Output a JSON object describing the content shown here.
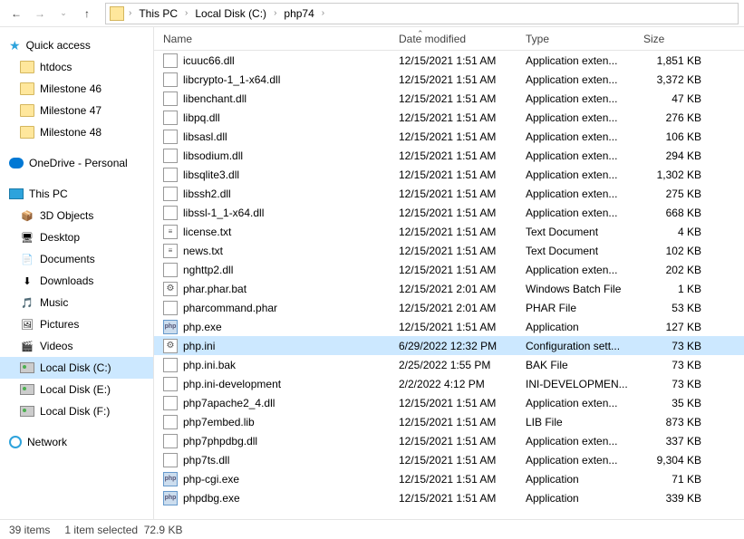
{
  "breadcrumbs": [
    "This PC",
    "Local Disk (C:)",
    "php74"
  ],
  "sidebar": {
    "quick": {
      "label": "Quick access",
      "items": [
        "htdocs",
        "Milestone 46",
        "Milestone 47",
        "Milestone 48"
      ]
    },
    "onedrive": "OneDrive - Personal",
    "thispc": {
      "label": "This PC",
      "items": [
        {
          "label": "3D Objects",
          "ico": "📦"
        },
        {
          "label": "Desktop",
          "ico": "🖥"
        },
        {
          "label": "Documents",
          "ico": "📄"
        },
        {
          "label": "Downloads",
          "ico": "⬇"
        },
        {
          "label": "Music",
          "ico": "🎵"
        },
        {
          "label": "Pictures",
          "ico": "🖼"
        },
        {
          "label": "Videos",
          "ico": "🎬"
        },
        {
          "label": "Local Disk (C:)",
          "ico": "drv",
          "sel": true
        },
        {
          "label": "Local Disk (E:)",
          "ico": "drv"
        },
        {
          "label": "Local Disk (F:)",
          "ico": "drv"
        }
      ]
    },
    "network": "Network"
  },
  "columns": {
    "name": "Name",
    "date": "Date modified",
    "type": "Type",
    "size": "Size"
  },
  "files": [
    {
      "n": "icuuc66.dll",
      "d": "12/15/2021 1:51 AM",
      "t": "Application exten...",
      "s": "1,851 KB",
      "i": "dll"
    },
    {
      "n": "libcrypto-1_1-x64.dll",
      "d": "12/15/2021 1:51 AM",
      "t": "Application exten...",
      "s": "3,372 KB",
      "i": "dll"
    },
    {
      "n": "libenchant.dll",
      "d": "12/15/2021 1:51 AM",
      "t": "Application exten...",
      "s": "47 KB",
      "i": "dll"
    },
    {
      "n": "libpq.dll",
      "d": "12/15/2021 1:51 AM",
      "t": "Application exten...",
      "s": "276 KB",
      "i": "dll"
    },
    {
      "n": "libsasl.dll",
      "d": "12/15/2021 1:51 AM",
      "t": "Application exten...",
      "s": "106 KB",
      "i": "dll"
    },
    {
      "n": "libsodium.dll",
      "d": "12/15/2021 1:51 AM",
      "t": "Application exten...",
      "s": "294 KB",
      "i": "dll"
    },
    {
      "n": "libsqlite3.dll",
      "d": "12/15/2021 1:51 AM",
      "t": "Application exten...",
      "s": "1,302 KB",
      "i": "dll"
    },
    {
      "n": "libssh2.dll",
      "d": "12/15/2021 1:51 AM",
      "t": "Application exten...",
      "s": "275 KB",
      "i": "dll"
    },
    {
      "n": "libssl-1_1-x64.dll",
      "d": "12/15/2021 1:51 AM",
      "t": "Application exten...",
      "s": "668 KB",
      "i": "dll"
    },
    {
      "n": "license.txt",
      "d": "12/15/2021 1:51 AM",
      "t": "Text Document",
      "s": "4 KB",
      "i": "txt"
    },
    {
      "n": "news.txt",
      "d": "12/15/2021 1:51 AM",
      "t": "Text Document",
      "s": "102 KB",
      "i": "txt"
    },
    {
      "n": "nghttp2.dll",
      "d": "12/15/2021 1:51 AM",
      "t": "Application exten...",
      "s": "202 KB",
      "i": "dll"
    },
    {
      "n": "phar.phar.bat",
      "d": "12/15/2021 2:01 AM",
      "t": "Windows Batch File",
      "s": "1 KB",
      "i": "bat"
    },
    {
      "n": "pharcommand.phar",
      "d": "12/15/2021 2:01 AM",
      "t": "PHAR File",
      "s": "53 KB",
      "i": "gen"
    },
    {
      "n": "php.exe",
      "d": "12/15/2021 1:51 AM",
      "t": "Application",
      "s": "127 KB",
      "i": "exe"
    },
    {
      "n": "php.ini",
      "d": "6/29/2022 12:32 PM",
      "t": "Configuration sett...",
      "s": "73 KB",
      "i": "ini",
      "sel": true
    },
    {
      "n": "php.ini.bak",
      "d": "2/25/2022 1:55 PM",
      "t": "BAK File",
      "s": "73 KB",
      "i": "gen"
    },
    {
      "n": "php.ini-development",
      "d": "2/2/2022 4:12 PM",
      "t": "INI-DEVELOPMEN...",
      "s": "73 KB",
      "i": "gen"
    },
    {
      "n": "php7apache2_4.dll",
      "d": "12/15/2021 1:51 AM",
      "t": "Application exten...",
      "s": "35 KB",
      "i": "dll"
    },
    {
      "n": "php7embed.lib",
      "d": "12/15/2021 1:51 AM",
      "t": "LIB File",
      "s": "873 KB",
      "i": "gen"
    },
    {
      "n": "php7phpdbg.dll",
      "d": "12/15/2021 1:51 AM",
      "t": "Application exten...",
      "s": "337 KB",
      "i": "dll"
    },
    {
      "n": "php7ts.dll",
      "d": "12/15/2021 1:51 AM",
      "t": "Application exten...",
      "s": "9,304 KB",
      "i": "dll"
    },
    {
      "n": "php-cgi.exe",
      "d": "12/15/2021 1:51 AM",
      "t": "Application",
      "s": "71 KB",
      "i": "exe"
    },
    {
      "n": "phpdbg.exe",
      "d": "12/15/2021 1:51 AM",
      "t": "Application",
      "s": "339 KB",
      "i": "exe"
    }
  ],
  "status": {
    "items": "39 items",
    "selected": "1 item selected",
    "size": "72.9 KB"
  }
}
